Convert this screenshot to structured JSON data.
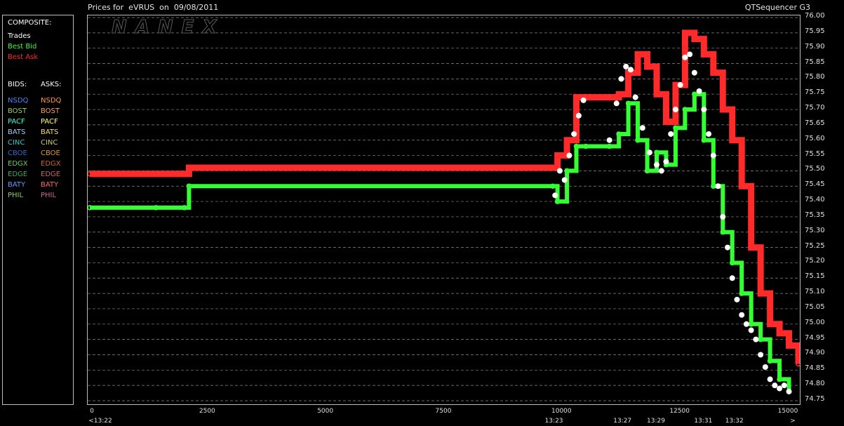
{
  "header": {
    "title": "Prices for  eVRUS  on  09/08/2011",
    "app_name": "QTSequencer G3"
  },
  "watermark": "NANEX",
  "legend": {
    "composite_title": "COMPOSITE:",
    "composite_items": [
      {
        "label": "Trades",
        "color": "#ffffff"
      },
      {
        "label": "Best Bid",
        "color": "#33ff33"
      },
      {
        "label": "Best Ask",
        "color": "#ff2a2a"
      }
    ],
    "bids_header": "BIDS:",
    "asks_header": "ASKS:",
    "exchanges": [
      {
        "bid": "NSDQ",
        "ask": "NSDQ",
        "bid_color": "#4a86ff",
        "ask_color": "#ff9a33"
      },
      {
        "bid": "BOST",
        "ask": "BOST",
        "bid_color": "#9acd66",
        "ask_color": "#ff9a66"
      },
      {
        "bid": "PACF",
        "ask": "PACF",
        "bid_color": "#33ffcc",
        "ask_color": "#ffff66"
      },
      {
        "bid": "BATS",
        "ask": "BATS",
        "bid_color": "#99ccff",
        "ask_color": "#ffdd66"
      },
      {
        "bid": "CINC",
        "ask": "CINC",
        "bid_color": "#33cccc",
        "ask_color": "#cccc66"
      },
      {
        "bid": "CBOE",
        "ask": "CBOE",
        "bid_color": "#3366cc",
        "ask_color": "#dd9933"
      },
      {
        "bid": "EDGX",
        "ask": "EDGX",
        "bid_color": "#66cc66",
        "ask_color": "#cc6633"
      },
      {
        "bid": "EDGE",
        "ask": "EDGE",
        "bid_color": "#33aa66",
        "ask_color": "#cc6666"
      },
      {
        "bid": "BATY",
        "ask": "BATY",
        "bid_color": "#6699ff",
        "ask_color": "#ff6666"
      },
      {
        "bid": "PHIL",
        "ask": "PHIL",
        "bid_color": "#99cc66",
        "ask_color": "#cc6699"
      }
    ]
  },
  "chart_data": {
    "type": "line",
    "title": "Prices for  eVRUS  on  09/08/2011",
    "xlabel": "",
    "ylabel": "",
    "xlim": [
      0,
      15000
    ],
    "ylim": [
      74.75,
      76.0
    ],
    "grid": true,
    "legend_position": "left",
    "x_ticks": [
      0,
      2500,
      5000,
      7500,
      10000,
      12500,
      15000
    ],
    "x_time_labels": [
      {
        "x": 0,
        "label": "<13:22"
      },
      {
        "x": 9840,
        "label": "13:23"
      },
      {
        "x": 11290,
        "label": "13:27"
      },
      {
        "x": 12000,
        "label": "13:29"
      },
      {
        "x": 13000,
        "label": "13:31"
      },
      {
        "x": 13660,
        "label": "13:32"
      },
      {
        "x": 14950,
        "label": ">"
      }
    ],
    "y_ticks": [
      74.75,
      74.8,
      74.85,
      74.9,
      74.95,
      75.0,
      75.05,
      75.1,
      75.15,
      75.2,
      75.25,
      75.3,
      75.35,
      75.4,
      75.45,
      75.5,
      75.55,
      75.6,
      75.65,
      75.7,
      75.75,
      75.8,
      75.85,
      75.9,
      75.95,
      76.0
    ],
    "y_tick_labels": [
      "74.75",
      "74.80",
      "74.85",
      "74.90",
      "74.95",
      "75.00",
      "75.05",
      "75.10",
      "75.15",
      "75.20",
      "75.25",
      "75.30",
      "75.35",
      "75.40",
      "75.45",
      "75.50",
      "75.55",
      "75.60",
      "75.65",
      "75.70",
      "75.75",
      "75.80",
      "75.85",
      "75.90",
      "75.95",
      "76.00"
    ],
    "series": [
      {
        "name": "Best Ask",
        "color": "#ff2a2a",
        "x": [
          0,
          2000,
          2100,
          9800,
          9900,
          10100,
          10300,
          10500,
          11000,
          11200,
          11400,
          11600,
          11800,
          12000,
          12200,
          12400,
          12600,
          12800,
          13000,
          13200,
          13400,
          13600,
          13800,
          14000,
          14200,
          14400,
          14600,
          14800,
          15000
        ],
        "y": [
          75.49,
          75.49,
          75.51,
          75.51,
          75.55,
          75.6,
          75.74,
          75.74,
          75.74,
          75.75,
          75.82,
          75.88,
          75.84,
          75.75,
          75.66,
          75.78,
          75.95,
          75.93,
          75.88,
          75.82,
          75.7,
          75.6,
          75.45,
          75.25,
          75.1,
          75.0,
          74.97,
          74.93,
          74.87
        ]
      },
      {
        "name": "Best Bid",
        "color": "#33ff33",
        "x": [
          0,
          1400,
          2000,
          2100,
          9800,
          9900,
          10100,
          10300,
          10500,
          11000,
          11200,
          11400,
          11600,
          11800,
          12000,
          12200,
          12400,
          12600,
          12800,
          13000,
          13200,
          13400,
          13600,
          13800,
          14000,
          14200,
          14400,
          14600,
          14800
        ],
        "y": [
          75.38,
          75.38,
          75.38,
          75.45,
          75.45,
          75.4,
          75.5,
          75.58,
          75.58,
          75.58,
          75.62,
          75.72,
          75.6,
          75.5,
          75.56,
          75.52,
          75.64,
          75.7,
          75.75,
          75.6,
          75.45,
          75.3,
          75.2,
          75.1,
          75.0,
          74.95,
          74.88,
          74.82,
          74.78
        ]
      },
      {
        "name": "Trades",
        "color": "#ffffff",
        "x": [
          9850,
          9950,
          10050,
          10150,
          10250,
          10350,
          10450,
          11000,
          11150,
          11250,
          11350,
          11450,
          11550,
          11700,
          11850,
          12000,
          12100,
          12200,
          12300,
          12400,
          12500,
          12600,
          12700,
          12800,
          12900,
          13000,
          13100,
          13200,
          13300,
          13400,
          13500,
          13600,
          13700,
          13800,
          13900,
          14000,
          14100,
          14200,
          14300,
          14400,
          14500,
          14600,
          14700,
          14800
        ],
        "y": [
          75.42,
          75.5,
          75.47,
          75.55,
          75.62,
          75.68,
          75.73,
          75.6,
          75.72,
          75.8,
          75.84,
          75.83,
          75.74,
          75.64,
          75.56,
          75.52,
          75.5,
          75.53,
          75.62,
          75.7,
          75.78,
          75.87,
          75.88,
          75.82,
          75.76,
          75.7,
          75.62,
          75.55,
          75.45,
          75.35,
          75.25,
          75.15,
          75.08,
          75.03,
          75.0,
          74.98,
          74.95,
          74.9,
          74.86,
          74.82,
          74.8,
          74.79,
          74.8,
          74.78
        ]
      }
    ]
  }
}
